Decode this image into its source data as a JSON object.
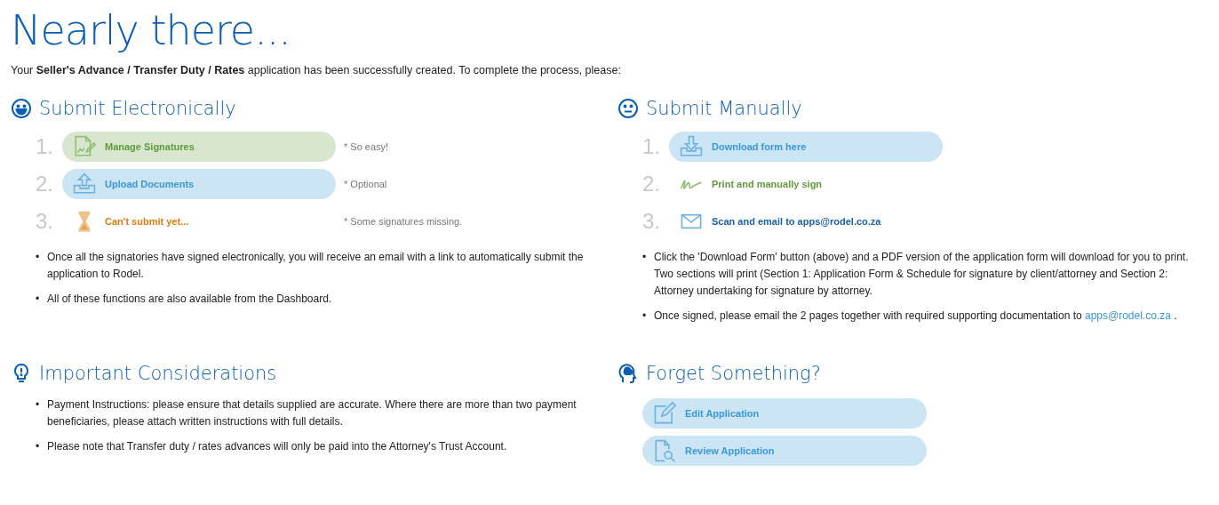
{
  "title": "Nearly there...",
  "intro": "Your **Seller's Advance / Transfer Duty / Rates** application has been successfully created. To complete the process, please:",
  "electronic": {
    "heading": "Submit Electronically",
    "steps": [
      {
        "number": "1.",
        "kind": "signatures",
        "label": "Manage Signatures",
        "note": "* So easy!"
      },
      {
        "number": "2.",
        "kind": "upload",
        "label": "Upload Documents",
        "note": "* Optional"
      },
      {
        "number": "3.",
        "kind": "waiting",
        "label": "Can't submit yet...",
        "note": "* Some signatures missing."
      }
    ],
    "bullets": [
      {
        "marker": "•",
        "text": "Once all the signatories have signed electronically, you will receive an email with a link to automatically submit the application to Rodel."
      },
      {
        "marker": "•",
        "text": "All of these functions are also available from the Dashboard."
      }
    ]
  },
  "manual": {
    "heading": "Submit Manually",
    "steps": [
      {
        "number": "1.",
        "kind": "download",
        "label": "Download form here"
      },
      {
        "number": "2.",
        "kind": "sign",
        "label": "Print and manually sign"
      },
      {
        "number": "3.",
        "kind": "email",
        "label": "Scan and email to apps@rodel.co.za"
      }
    ],
    "bullets": [
      {
        "marker": "•",
        "text": "Click the 'Download Form' button (above) and a PDF version of the application form will download for you to print. Two sections will print (Section 1: Application Form & Schedule for signature by client/attorney and Section 2: Attorney undertaking for signature by attorney."
      },
      {
        "marker": "•",
        "text": "Once signed, please email the 2 pages together with required supporting documentation to",
        "link": "apps@rodel.co.za",
        "after": "."
      }
    ]
  },
  "considerations": {
    "heading": "Important Considerations",
    "bullets": [
      {
        "marker": "•",
        "text": "Payment Instructions: please ensure that details supplied are accurate. Where there are more than two payment beneficiaries, please attach written instructions with full details."
      },
      {
        "marker": "•",
        "text": "Please note that Transfer duty / rates advances will only be paid into the Attorney's Trust Account."
      }
    ]
  },
  "forget": {
    "heading": "Forget Something?",
    "buttons": [
      {
        "kind": "edit",
        "label": "Edit Application"
      },
      {
        "kind": "review",
        "label": "Review Application"
      }
    ]
  }
}
